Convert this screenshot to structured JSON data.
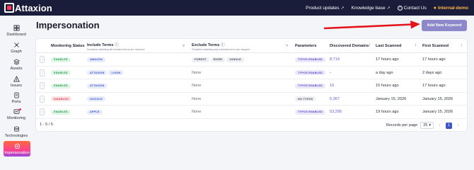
{
  "brand": {
    "name": "Attaxion"
  },
  "topnav": {
    "items": [
      {
        "label": "Product updates",
        "icon": "external-link-icon"
      },
      {
        "label": "Knowledge base",
        "icon": "external-link-icon"
      },
      {
        "label": "Contact Us",
        "icon": "help-circle-icon"
      }
    ],
    "user": "Internal-demo"
  },
  "sidebar": {
    "items": [
      {
        "label": "Dashboard",
        "icon": "dashboard-icon"
      },
      {
        "label": "Graph",
        "icon": "graph-icon"
      },
      {
        "label": "Assets",
        "icon": "assets-icon"
      },
      {
        "label": "Issues",
        "icon": "issues-icon"
      },
      {
        "label": "Ports",
        "icon": "ports-icon"
      },
      {
        "label": "Monitoring",
        "icon": "monitoring-icon"
      },
      {
        "label": "Technologies",
        "icon": "technologies-icon"
      },
      {
        "label": "Impersonation",
        "icon": "impersonation-icon",
        "active": true
      }
    ]
  },
  "page": {
    "title": "Impersonation",
    "add_button": "Add New Keyword"
  },
  "table": {
    "columns": {
      "status": "Monitoring Status",
      "include": "Include Terms",
      "include_sub": "Domains matching all included terms are returned",
      "exclude": "Exclude Terms",
      "exclude_sub": "Domains matching any excluded term are skipped",
      "params": "Parameters",
      "discovered": "Discovered Domains",
      "last": "Last Scanned",
      "first": "First Scanned"
    },
    "rows": [
      {
        "status": "ENABLED",
        "include": [
          "AMAZON"
        ],
        "exclude": [
          "FOREST",
          "RIVER",
          "JUNGLE"
        ],
        "params": "TYPOS ENABLED",
        "discovered": "8,714",
        "last": "17 hours ago",
        "first": "17 hours ago"
      },
      {
        "status": "ENABLED",
        "include": [
          "ATTAXION",
          "LOGIN"
        ],
        "exclude": [],
        "exclude_none": "None",
        "params": "TYPOS ENABLED",
        "discovered": "-",
        "last": "a day ago",
        "first": "2 days ago"
      },
      {
        "status": "ENABLED",
        "include": [
          "ATTAXION"
        ],
        "exclude": [],
        "exclude_none": "None",
        "params": "TYPOS ENABLED",
        "discovered": "16",
        "last": "15 hours ago",
        "first": "17 hours ago"
      },
      {
        "status": "DISABLED",
        "include": [
          "GOOGLE"
        ],
        "exclude": [],
        "exclude_none": "None",
        "params": "NO TYPOS",
        "discovered": "5,367",
        "last": "January 15, 2026",
        "first": "January 15, 2026"
      },
      {
        "status": "ENABLED",
        "include": [
          "APPLE"
        ],
        "exclude": [],
        "exclude_none": "None",
        "params": "TYPOS ENABLED",
        "discovered": "53,295",
        "last": "19 hours ago",
        "first": "January 15, 2026"
      }
    ],
    "footer": {
      "range": "1 - 5 / 5",
      "per_page_label": "Records per page",
      "per_page": "25",
      "page": "1"
    }
  }
}
